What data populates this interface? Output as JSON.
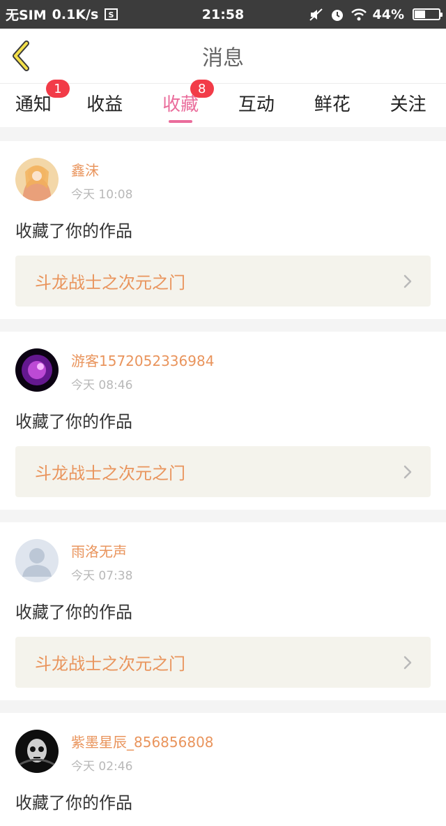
{
  "status_bar": {
    "carrier": "无SIM",
    "speed": "0.1K/s",
    "time": "21:58",
    "battery": "44%",
    "battery_level": 0.44
  },
  "nav": {
    "title": "消息"
  },
  "tabs": [
    {
      "label": "通知",
      "badge": "1",
      "active": false
    },
    {
      "label": "收益",
      "badge": "",
      "active": false
    },
    {
      "label": "收藏",
      "badge": "8",
      "active": true
    },
    {
      "label": "互动",
      "badge": "",
      "active": false
    },
    {
      "label": "鲜花",
      "badge": "",
      "active": false
    },
    {
      "label": "关注",
      "badge": "",
      "active": false
    }
  ],
  "messages": [
    {
      "user": "鑫沫",
      "time": "今天 10:08",
      "action": "收藏了你的作品",
      "work": "斗龙战士之次元之门"
    },
    {
      "user": "游客1572052336984",
      "time": "今天 08:46",
      "action": "收藏了你的作品",
      "work": "斗龙战士之次元之门"
    },
    {
      "user": "雨洛无声",
      "time": "今天 07:38",
      "action": "收藏了你的作品",
      "work": "斗龙战士之次元之门"
    },
    {
      "user": "紫墨星辰_856856808",
      "time": "今天 02:46",
      "action": "收藏了你的作品",
      "work": ""
    }
  ],
  "colors": {
    "accent": "#ea6c9b",
    "username": "#e9945c",
    "badge": "#f23b48"
  }
}
